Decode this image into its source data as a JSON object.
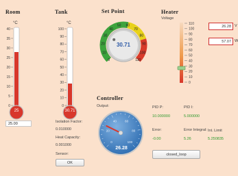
{
  "room": {
    "title": "Room",
    "unit": "°C",
    "ticks": [
      "40",
      "35",
      "30",
      "25",
      "20",
      "15",
      "10",
      "5",
      "0"
    ],
    "bulb_value": "25",
    "input_value": "25.00"
  },
  "tank": {
    "title": "Tank",
    "unit": "°C",
    "ticks": [
      "100",
      "90",
      "80",
      "70",
      "60",
      "50",
      "40",
      "30",
      "20",
      "10",
      "0"
    ],
    "bulb_value": "30.71"
  },
  "tank_params": {
    "isolation_label": "Isolation Factor:",
    "isolation_value": "0.010000",
    "heatcap_label": "Heat Capacity:",
    "heatcap_value": "0.001000",
    "sensor_label": "Sensor:",
    "ok_label": "OK"
  },
  "setpoint": {
    "title": "Set Point",
    "value": "30.71",
    "ticks": [
      "0",
      "10",
      "20",
      "30",
      "40",
      "50",
      "60",
      "70",
      "80",
      "90",
      "100",
      "110"
    ],
    "level": 30.71
  },
  "heater": {
    "title": "Heater",
    "voltage_label": "Voltage",
    "ticks": [
      "110",
      "100",
      "90",
      "80",
      "70",
      "60",
      "50",
      "40",
      "30",
      "20",
      "10",
      "0"
    ],
    "box1_value": "26.28",
    "box1_unit": "V",
    "box2_value": "57.07",
    "box2_unit": "W",
    "level": 26.28
  },
  "controller": {
    "title": "Controller",
    "output_label": "Output:",
    "value": "26.28",
    "ticks": [
      "0",
      "20",
      "40",
      "60",
      "80",
      "100"
    ],
    "level": 26.28
  },
  "pid": {
    "p_label": "PID P:",
    "p_value": "10.000000",
    "i_label": "PID I:",
    "i_value": "5.000000",
    "error_label": "Error:",
    "error_value": "-0.00",
    "integral_label": "Error Integral:",
    "integral_value": "5.26",
    "limit_label": "Int. Limit",
    "limit_value": "5.250835",
    "loop_button": "closed_loop"
  },
  "colors": {
    "background": "#fbe1cc",
    "mercury": "#d8372b",
    "gauge_blue": "#3f7dc3",
    "value_green": "#2f9a2f",
    "box_border_red": "#d03030"
  }
}
